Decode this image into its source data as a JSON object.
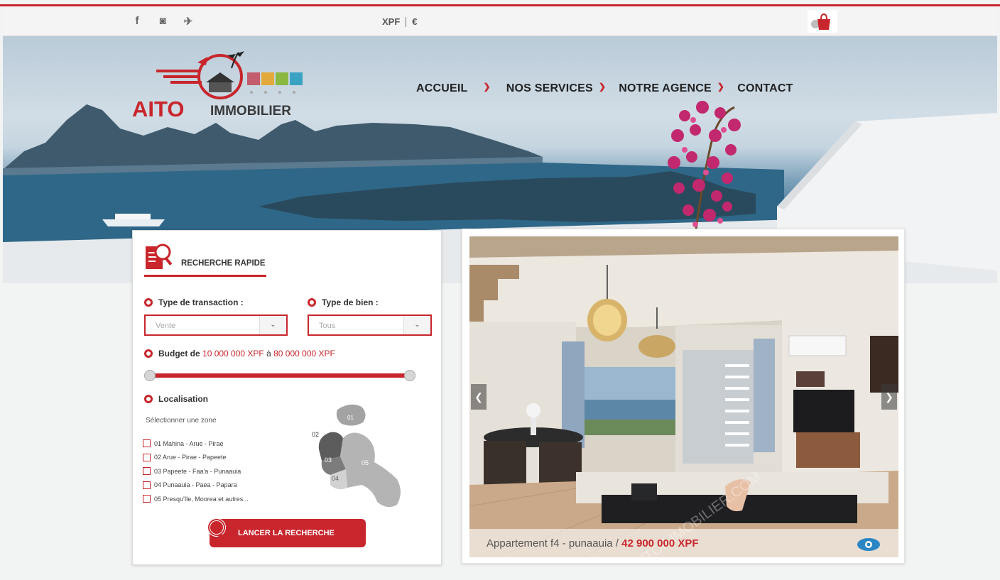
{
  "topbar": {
    "social": [
      {
        "icon": "facebook-icon",
        "glyph": "f"
      },
      {
        "icon": "instagram-icon",
        "glyph": "◙"
      },
      {
        "icon": "twitter-icon",
        "glyph": "✈"
      }
    ],
    "currencies": [
      "XPF",
      "€"
    ],
    "cart_icon": "shopping-bag-icon"
  },
  "brand": {
    "name": "AITO",
    "subtitle": "IMMOBILIER",
    "accent_color": "#c8262c"
  },
  "nav": {
    "items": [
      "ACCUEIL",
      "NOS SERVICES",
      "NOTRE AGENCE",
      "CONTACT"
    ]
  },
  "search": {
    "title": "RECHERCHE RAPIDE",
    "transaction_label": "Type de transaction :",
    "transaction_value": "Vente",
    "property_label": "Type de bien :",
    "property_value": "Tous",
    "budget_prefix": "Budget de",
    "budget_min": "10 000 000 XPF",
    "budget_middle": "à",
    "budget_max": "80 000 000 XPF",
    "location_label": "Localisation",
    "zone_hint": "Sélectionner une zone",
    "zones": [
      "01 Mahina - Arue - Pirae",
      "02 Arue - Pirae - Papeete",
      "03 Papeete - Faa'a - Punaauia",
      "04 Punaauia - Paea - Papara",
      "05 Presqu'île, Moorea et autres..."
    ],
    "map_labels": [
      "01",
      "02",
      "03",
      "04",
      "05"
    ],
    "submit_label": "LANCER LA RECHERCHE"
  },
  "listing": {
    "title": "Appartement f4 - punaauia /",
    "price": "42 900 000 XPF",
    "watermark": "AITOIMMOBILIER.COM"
  }
}
